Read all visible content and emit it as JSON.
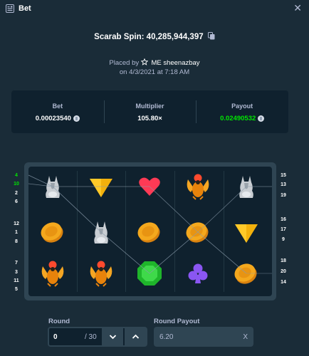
{
  "window": {
    "title": "Bet",
    "title_icon": "bet-icon",
    "close_icon": "close-icon",
    "close_glyph": "✕"
  },
  "header": {
    "label": "Scarab Spin:",
    "bet_id": "40,285,944,397",
    "copy_icon": "copy-icon"
  },
  "placed": {
    "prefix": "Placed by",
    "user_icon": "star-icon",
    "username": "ME sheenazbay",
    "date_line": "on 4/3/2021 at 7:18 AM"
  },
  "stats": {
    "bet_label": "Bet",
    "bet_value": "0.00023540",
    "multiplier_label": "Multiplier",
    "multiplier_value": "105.80×",
    "payout_label": "Payout",
    "payout_value": "0.02490532",
    "currency_icon": "coin-icon",
    "payout_color": "#00e701"
  },
  "reels": {
    "grid": [
      [
        "jackal",
        "pyramid",
        "heart",
        "scarab",
        "jackal"
      ],
      [
        "coin",
        "jackal",
        "coin",
        "coin",
        "pyramid"
      ],
      [
        "scarab",
        "scarab",
        "emerald",
        "club",
        "coin"
      ]
    ],
    "left_lines": [
      {
        "label": "4",
        "active": true
      },
      {
        "label": "10",
        "active": true
      },
      {
        "label": "2",
        "active": false
      },
      {
        "label": "6",
        "active": false
      },
      {
        "label": "12",
        "active": false
      },
      {
        "label": "1",
        "active": false
      },
      {
        "label": "8",
        "active": false
      },
      {
        "label": "7",
        "active": false
      },
      {
        "label": "3",
        "active": false
      },
      {
        "label": "11",
        "active": false
      },
      {
        "label": "5",
        "active": false
      }
    ],
    "right_lines": [
      {
        "label": "15"
      },
      {
        "label": "13"
      },
      {
        "label": "19"
      },
      {
        "label": "16"
      },
      {
        "label": "17"
      },
      {
        "label": "9"
      },
      {
        "label": "18"
      },
      {
        "label": "20"
      },
      {
        "label": "14"
      }
    ]
  },
  "round": {
    "label": "Round",
    "value": "0",
    "total": "/ 30",
    "prev_icon": "chevron-down-icon",
    "next_icon": "chevron-up-icon"
  },
  "round_payout": {
    "label": "Round Payout",
    "value": "6.20",
    "suffix": "X"
  }
}
